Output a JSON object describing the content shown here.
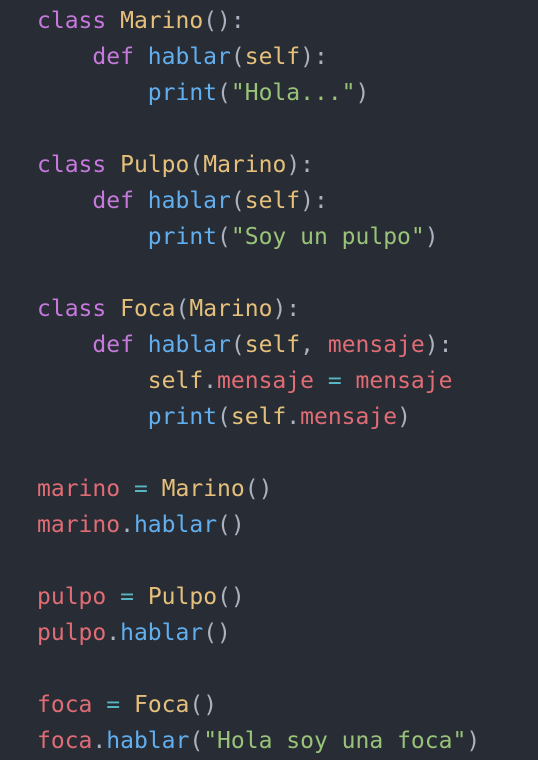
{
  "colors": {
    "background": "#282c34",
    "keyword": "#c678dd",
    "class": "#e5c07b",
    "self": "#e5c07b",
    "func": "#61afef",
    "string": "#98c379",
    "var": "#e06c75",
    "op": "#56b6c2",
    "punct": "#abb2bf"
  },
  "code": {
    "lines": [
      [
        [
          "keyword",
          "class"
        ],
        [
          "ws",
          " "
        ],
        [
          "class",
          "Marino"
        ],
        [
          "punct",
          "():"
        ]
      ],
      [
        [
          "ws",
          "    "
        ],
        [
          "keyword",
          "def"
        ],
        [
          "ws",
          " "
        ],
        [
          "func",
          "hablar"
        ],
        [
          "punct",
          "("
        ],
        [
          "self",
          "self"
        ],
        [
          "punct",
          "):"
        ]
      ],
      [
        [
          "ws",
          "        "
        ],
        [
          "func",
          "print"
        ],
        [
          "punct",
          "("
        ],
        [
          "string",
          "\"Hola...\""
        ],
        [
          "punct",
          ")"
        ]
      ],
      [],
      [
        [
          "keyword",
          "class"
        ],
        [
          "ws",
          " "
        ],
        [
          "class",
          "Pulpo"
        ],
        [
          "punct",
          "("
        ],
        [
          "class",
          "Marino"
        ],
        [
          "punct",
          "):"
        ]
      ],
      [
        [
          "ws",
          "    "
        ],
        [
          "keyword",
          "def"
        ],
        [
          "ws",
          " "
        ],
        [
          "func",
          "hablar"
        ],
        [
          "punct",
          "("
        ],
        [
          "self",
          "self"
        ],
        [
          "punct",
          "):"
        ]
      ],
      [
        [
          "ws",
          "        "
        ],
        [
          "func",
          "print"
        ],
        [
          "punct",
          "("
        ],
        [
          "string",
          "\"Soy un pulpo\""
        ],
        [
          "punct",
          ")"
        ]
      ],
      [],
      [
        [
          "keyword",
          "class"
        ],
        [
          "ws",
          " "
        ],
        [
          "class",
          "Foca"
        ],
        [
          "punct",
          "("
        ],
        [
          "class",
          "Marino"
        ],
        [
          "punct",
          "):"
        ]
      ],
      [
        [
          "ws",
          "    "
        ],
        [
          "keyword",
          "def"
        ],
        [
          "ws",
          " "
        ],
        [
          "func",
          "hablar"
        ],
        [
          "punct",
          "("
        ],
        [
          "self",
          "self"
        ],
        [
          "punct",
          ", "
        ],
        [
          "var",
          "mensaje"
        ],
        [
          "punct",
          "):"
        ]
      ],
      [
        [
          "ws",
          "        "
        ],
        [
          "self",
          "self"
        ],
        [
          "punct",
          "."
        ],
        [
          "var",
          "mensaje"
        ],
        [
          "ws",
          " "
        ],
        [
          "op",
          "="
        ],
        [
          "ws",
          " "
        ],
        [
          "var",
          "mensaje"
        ]
      ],
      [
        [
          "ws",
          "        "
        ],
        [
          "func",
          "print"
        ],
        [
          "punct",
          "("
        ],
        [
          "self",
          "self"
        ],
        [
          "punct",
          "."
        ],
        [
          "var",
          "mensaje"
        ],
        [
          "punct",
          ")"
        ]
      ],
      [],
      [
        [
          "var",
          "marino"
        ],
        [
          "ws",
          " "
        ],
        [
          "op",
          "="
        ],
        [
          "ws",
          " "
        ],
        [
          "class",
          "Marino"
        ],
        [
          "punct",
          "()"
        ]
      ],
      [
        [
          "var",
          "marino"
        ],
        [
          "punct",
          "."
        ],
        [
          "func",
          "hablar"
        ],
        [
          "punct",
          "()"
        ]
      ],
      [],
      [
        [
          "var",
          "pulpo"
        ],
        [
          "ws",
          " "
        ],
        [
          "op",
          "="
        ],
        [
          "ws",
          " "
        ],
        [
          "class",
          "Pulpo"
        ],
        [
          "punct",
          "()"
        ]
      ],
      [
        [
          "var",
          "pulpo"
        ],
        [
          "punct",
          "."
        ],
        [
          "func",
          "hablar"
        ],
        [
          "punct",
          "()"
        ]
      ],
      [],
      [
        [
          "var",
          "foca"
        ],
        [
          "ws",
          " "
        ],
        [
          "op",
          "="
        ],
        [
          "ws",
          " "
        ],
        [
          "class",
          "Foca"
        ],
        [
          "punct",
          "()"
        ]
      ],
      [
        [
          "var",
          "foca"
        ],
        [
          "punct",
          "."
        ],
        [
          "func",
          "hablar"
        ],
        [
          "punct",
          "("
        ],
        [
          "string",
          "\"Hola soy una foca\""
        ],
        [
          "punct",
          ")"
        ]
      ]
    ]
  }
}
